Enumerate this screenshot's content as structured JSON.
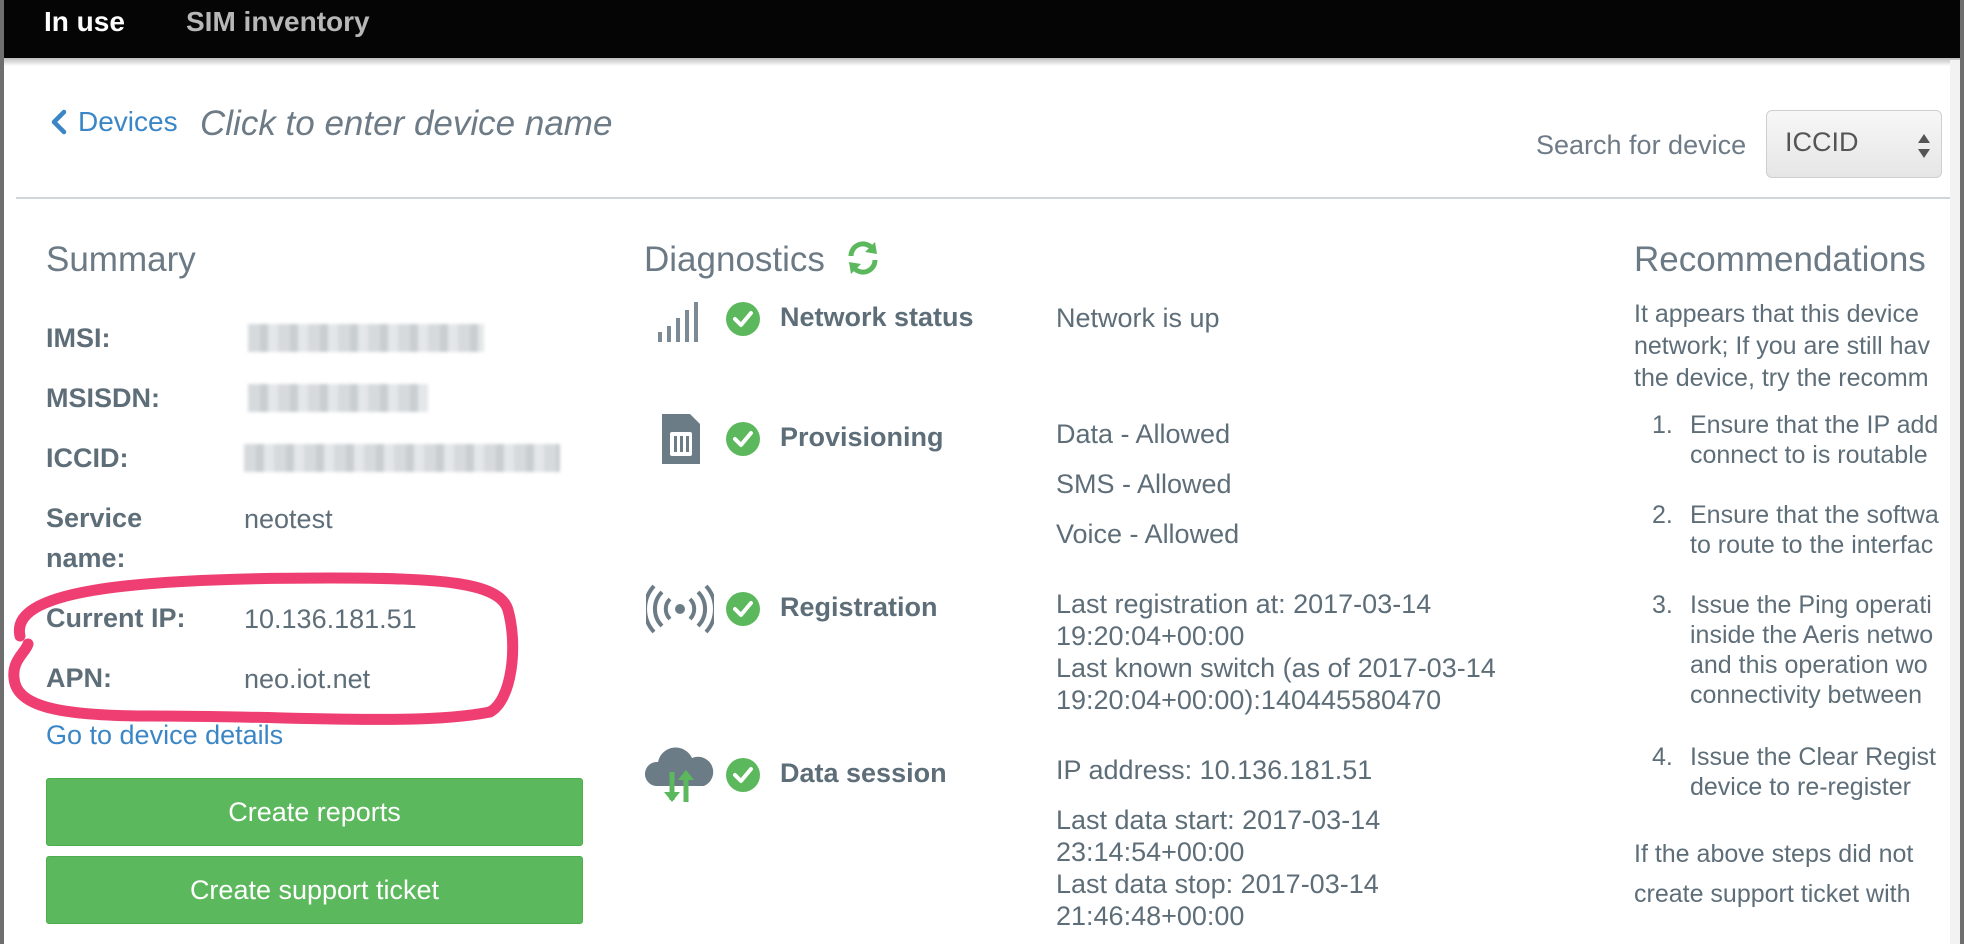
{
  "nav": {
    "tabs": [
      {
        "label": "In use"
      },
      {
        "label": "SIM inventory"
      }
    ]
  },
  "header": {
    "back_label": "Devices",
    "device_name_placeholder": "Click to enter device name",
    "search_label": "Search for device",
    "search_type": "ICCID"
  },
  "summary": {
    "title": "Summary",
    "fields": [
      {
        "label": "IMSI:",
        "value": ""
      },
      {
        "label": "MSISDN:",
        "value": ""
      },
      {
        "label": "ICCID:",
        "value": ""
      },
      {
        "label": "Service name:",
        "value": "neotest"
      },
      {
        "label": "Current IP:",
        "value": "10.136.181.51"
      },
      {
        "label": "APN:",
        "value": "neo.iot.net"
      }
    ],
    "details_link": "Go to device details",
    "buttons": [
      {
        "label": "Create reports"
      },
      {
        "label": "Create support ticket"
      }
    ]
  },
  "diagnostics": {
    "title": "Diagnostics",
    "items": [
      {
        "name": "Network status",
        "icon": "signal-bars-icon",
        "lines": [
          "Network is up"
        ]
      },
      {
        "name": "Provisioning",
        "icon": "sim-card-icon",
        "lines": [
          "Data - Allowed",
          "SMS - Allowed",
          "Voice - Allowed"
        ]
      },
      {
        "name": "Registration",
        "icon": "broadcast-icon",
        "lines": [
          "Last registration at: 2017-03-14",
          "19:20:04+00:00",
          "Last known switch (as of 2017-03-14",
          "19:20:04+00:00):140445580470"
        ]
      },
      {
        "name": "Data session",
        "icon": "cloud-transfer-icon",
        "lines": [
          "IP address: 10.136.181.51",
          "Last data start: 2017-03-14",
          "23:14:54+00:00",
          "Last data stop: 2017-03-14",
          "21:46:48+00:00"
        ]
      }
    ]
  },
  "recommendations": {
    "title": "Recommendations",
    "intro": [
      "It appears that this device",
      "network; If you are still hav",
      "the device, try the recomm"
    ],
    "steps": [
      {
        "num": "1.",
        "lines": [
          "Ensure that the IP add",
          "connect to is routable"
        ]
      },
      {
        "num": "2.",
        "lines": [
          "Ensure that the softwa",
          "to route to the interfac"
        ]
      },
      {
        "num": "3.",
        "lines": [
          "Issue the Ping operati",
          "inside the Aeris netwo",
          "and this operation wo",
          "connectivity between"
        ]
      },
      {
        "num": "4.",
        "lines": [
          "Issue the Clear Regist",
          "device to re-register"
        ]
      }
    ],
    "outro": [
      "If the above steps did not",
      "create support ticket with"
    ]
  },
  "colors": {
    "link": "#3b86c6",
    "success": "#5cb85c",
    "text": "#5e6e79",
    "annotation": "#ef3e72"
  }
}
